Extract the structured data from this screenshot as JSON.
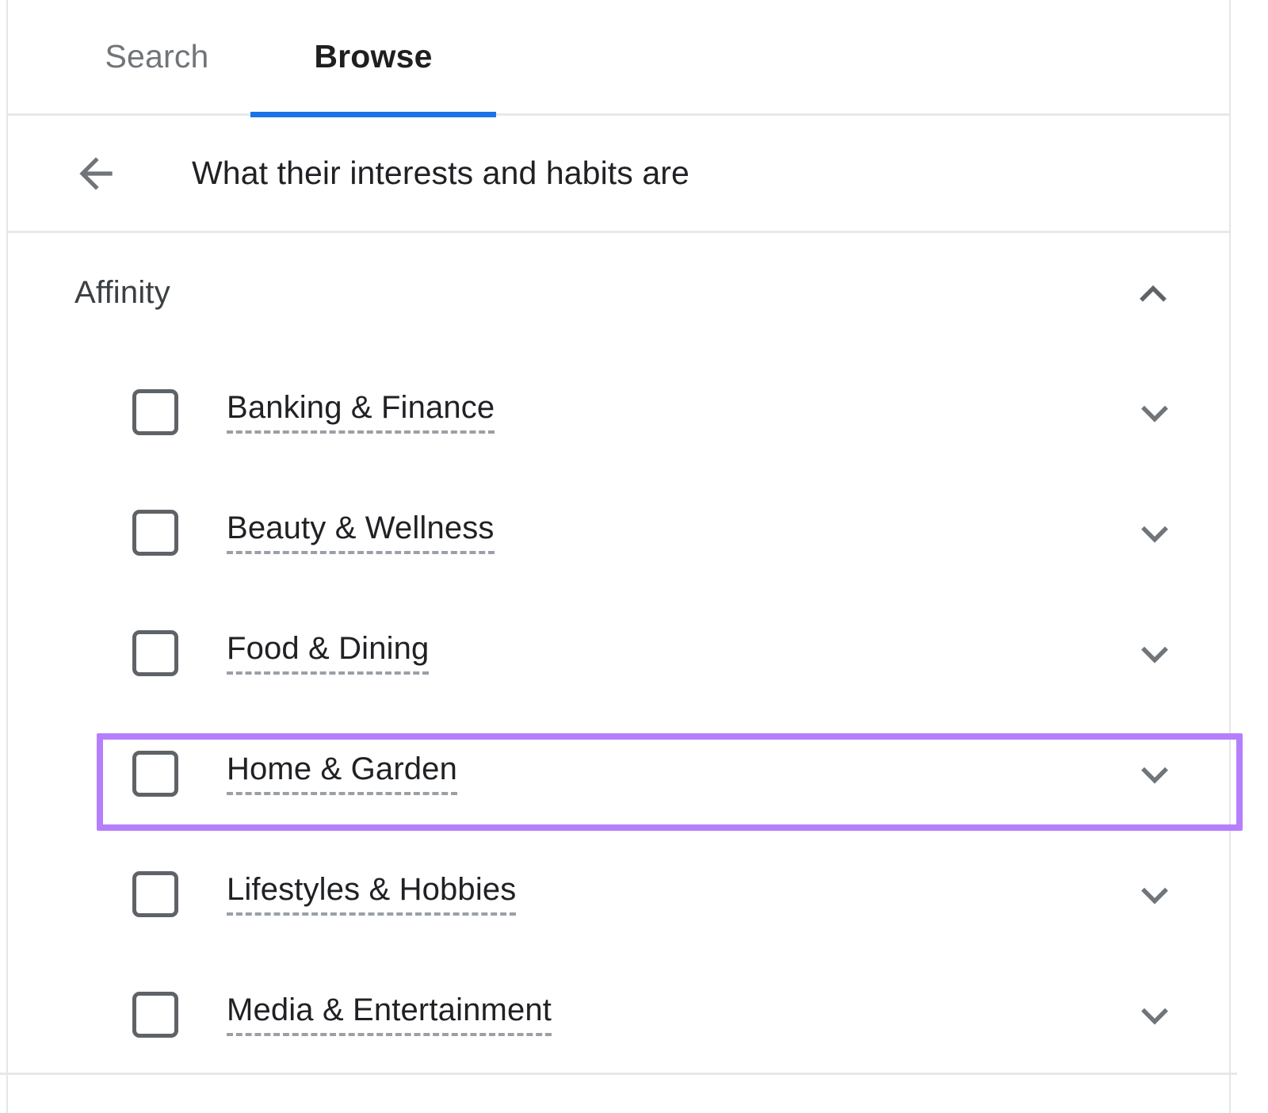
{
  "tabs": [
    {
      "label": "Search",
      "active": false,
      "name": "tab-search"
    },
    {
      "label": "Browse",
      "active": true,
      "name": "tab-browse"
    }
  ],
  "header": {
    "back_icon": "arrow-left-icon",
    "title": "What their interests and habits are"
  },
  "section": {
    "title": "Affinity",
    "collapse_icon": "chevron-up-icon",
    "expanded": true
  },
  "options": [
    {
      "label": "Banking & Finance",
      "checked": false,
      "expand_icon": "chevron-down-icon",
      "highlighted": false
    },
    {
      "label": "Beauty & Wellness",
      "checked": false,
      "expand_icon": "chevron-down-icon",
      "highlighted": false
    },
    {
      "label": "Food & Dining",
      "checked": false,
      "expand_icon": "chevron-down-icon",
      "highlighted": false
    },
    {
      "label": "Home & Garden",
      "checked": false,
      "expand_icon": "chevron-down-icon",
      "highlighted": true
    },
    {
      "label": "Lifestyles & Hobbies",
      "checked": false,
      "expand_icon": "chevron-down-icon",
      "highlighted": false
    },
    {
      "label": "Media & Entertainment",
      "checked": false,
      "expand_icon": "chevron-down-icon",
      "highlighted": false
    }
  ],
  "colors": {
    "accent_blue": "#1a73e8",
    "highlight_purple": "#b57ffc",
    "text_primary": "#202124",
    "text_secondary": "#70757a",
    "icon_gray": "#5f6368",
    "divider": "#e7e8ea"
  }
}
